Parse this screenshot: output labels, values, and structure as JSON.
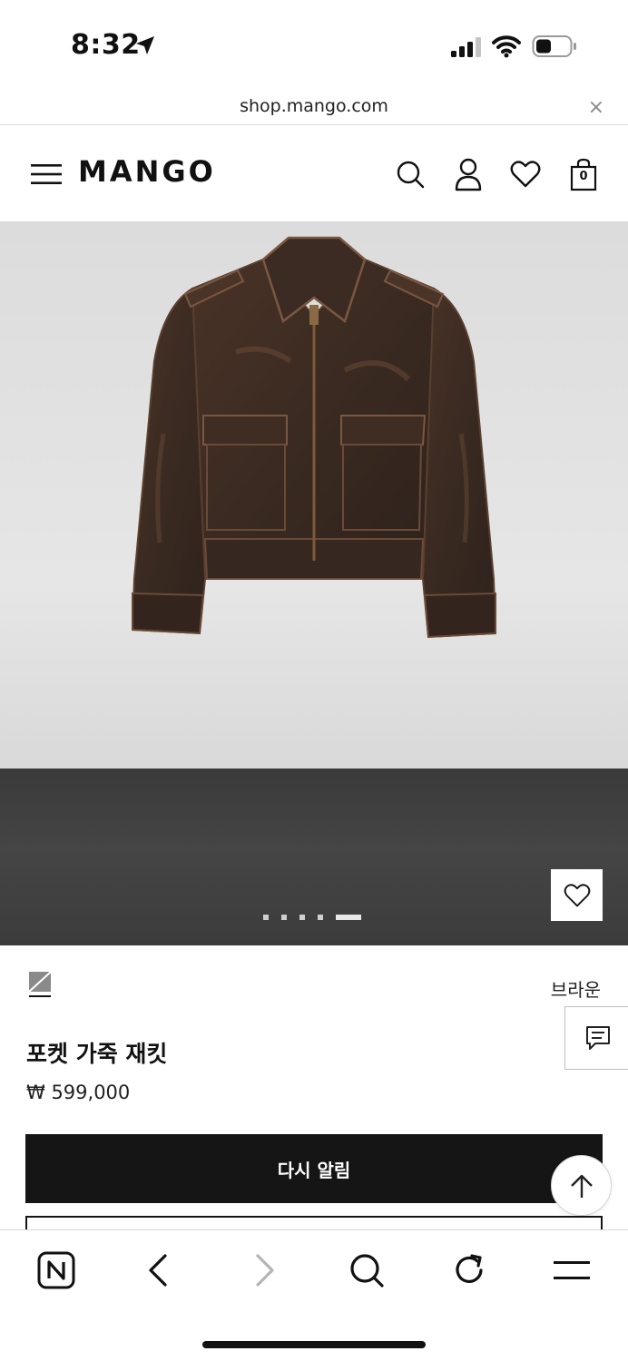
{
  "status_bar": {
    "time": "8:32",
    "icons": [
      "location-arrow-icon",
      "cellular-signal-icon",
      "wifi-icon",
      "battery-icon"
    ]
  },
  "browser": {
    "url": "shop.mango.com",
    "close_glyph": "×",
    "toolbar_icons": [
      "naver-home-icon",
      "back-icon",
      "forward-icon",
      "search-icon",
      "reload-icon",
      "menu-icon"
    ]
  },
  "header": {
    "logo": "MANGO",
    "bag_count": "0",
    "icons": [
      "hamburger-menu-icon",
      "search-icon",
      "user-icon",
      "heart-icon",
      "shopping-bag-icon"
    ]
  },
  "gallery": {
    "image_count": 5,
    "active_index": 4
  },
  "product": {
    "color_name": "브라운",
    "title": "포켓 가죽 재킷",
    "price": "₩ 599,000",
    "notify_label": "다시 알림"
  },
  "colors": {
    "brand_black": "#151515",
    "jacket_brown": "#3e2c22",
    "floor_gray": "#3f3f3f"
  }
}
